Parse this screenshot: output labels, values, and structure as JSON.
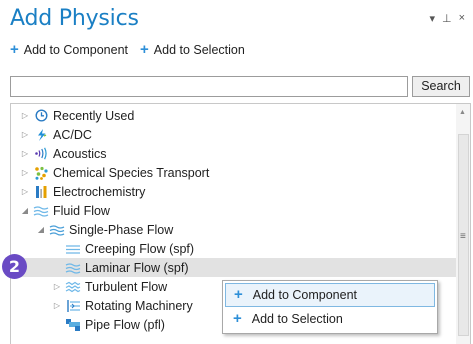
{
  "panel": {
    "title": "Add Physics"
  },
  "window_controls": {
    "menu": "▾",
    "pin": "⊥",
    "close": "×"
  },
  "toolbar": {
    "add_to_component": "Add to Component",
    "add_to_selection": "Add to Selection"
  },
  "search": {
    "value": "",
    "button": "Search"
  },
  "tree": [
    {
      "label": "Recently Used",
      "icon": "clock-icon"
    },
    {
      "label": "AC/DC",
      "icon": "acdc-icon"
    },
    {
      "label": "Acoustics",
      "icon": "acoustics-icon"
    },
    {
      "label": "Chemical Species Transport",
      "icon": "chemical-icon"
    },
    {
      "label": "Electrochemistry",
      "icon": "electrochemistry-icon"
    },
    {
      "label": "Fluid Flow",
      "icon": "fluid-flow-icon"
    },
    {
      "label": "Single-Phase Flow",
      "icon": "single-phase-flow-icon"
    },
    {
      "label": "Creeping Flow (spf)",
      "icon": "creeping-flow-icon"
    },
    {
      "label": "Laminar Flow (spf)",
      "icon": "laminar-flow-icon"
    },
    {
      "label": "Turbulent Flow",
      "icon": "turbulent-flow-icon"
    },
    {
      "label": "Rotating Machinery",
      "icon": "rotating-machinery-icon"
    },
    {
      "label": "Pipe Flow (pfl)",
      "icon": "pipe-flow-icon"
    }
  ],
  "badge": "2",
  "context_menu": {
    "add_to_component": "Add to Component",
    "add_to_selection": "Add to Selection"
  },
  "colors": {
    "title": "#1a7fc4",
    "accent": "#2d8fd8",
    "badge": "#6a4bc4",
    "selected_row": "#e2e2e2"
  }
}
